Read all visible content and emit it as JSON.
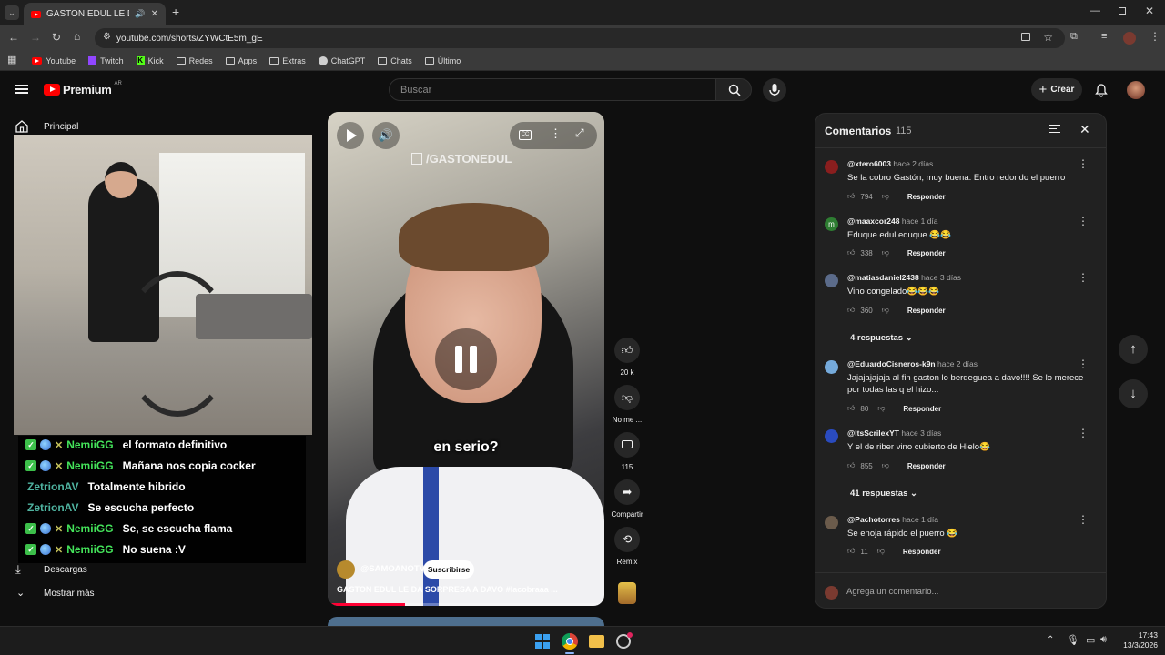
{
  "browser": {
    "tab_title": "GASTON EDUL LE DA SORP",
    "url": "youtube.com/shorts/ZYWCtE5m_gE",
    "bookmarks": [
      "Youtube",
      "Twitch",
      "Kick",
      "Redes",
      "Apps",
      "Extras",
      "ChatGPT",
      "Chats",
      "Último"
    ]
  },
  "youtube": {
    "logo_text": "Premium",
    "logo_country": "AR",
    "search_placeholder": "Buscar",
    "create_label": "Crear",
    "sidebar": {
      "home": "Principal",
      "downloads": "Descargas",
      "show_more": "Mostrar más"
    }
  },
  "chat": [
    {
      "user": "NemiiGG",
      "message": "el formato definitivo",
      "badges": true
    },
    {
      "user": "NemiiGG",
      "message": "Mañana nos copia cocker",
      "badges": true
    },
    {
      "user": "ZetrionAV",
      "message": "Totalmente hibrido",
      "badges": false
    },
    {
      "user": "ZetrionAV",
      "message": "Se escucha perfecto",
      "badges": false
    },
    {
      "user": "NemiiGG",
      "message": "Se, se escucha flama",
      "badges": true
    },
    {
      "user": "NemiiGG",
      "message": "No suena :V",
      "badges": true
    }
  ],
  "short": {
    "watermark": "/GASTONEDUL",
    "caption": "en serio?",
    "channel": "@SAMOANOTV",
    "subscribe_label": "Suscribirse",
    "title": "GASTON EDUL LE DA SORPRESA A DAVO ",
    "hashtag": "#lacobraaa ...",
    "progress_fraction": 0.28,
    "actions": {
      "likes": "20 k",
      "dislike_label": "No me ...",
      "comments": "115",
      "share_label": "Compartir",
      "remix_label": "Remix"
    }
  },
  "comments_panel": {
    "title": "Comentarios",
    "count": "115",
    "add_placeholder": "Agrega un comentario...",
    "reply_label": "Responder",
    "items": [
      {
        "author": "@xtero6003",
        "time": "hace 2 días",
        "text": "Se la cobro Gastón, muy buena. Entro redondo el puerro",
        "likes": "794",
        "avatar_color": "#8a1e1e"
      },
      {
        "author": "@maaxcor248",
        "time": "hace 1 día",
        "text": "Eduque edul eduque 😂😂",
        "likes": "338",
        "avatar_color": "#2e7d32",
        "avatar_letter": "m"
      },
      {
        "author": "@matiasdaniel2438",
        "time": "hace 3 días",
        "text": "Vino congelado😂😂😂",
        "likes": "360",
        "avatar_color": "#5b6b8a",
        "replies": "4 respuestas"
      },
      {
        "author": "@EduardoCisneros-k9n",
        "time": "hace 2 días",
        "text": "Jajajajajaja al fin gaston lo berdeguea a davo!!!! Se lo merece por todas las q el hizo...",
        "likes": "80",
        "avatar_color": "#75aadb"
      },
      {
        "author": "@ItsScrilexYT",
        "time": "hace 3 días",
        "text": "Y el de riber vino cubierto de Hielo😂",
        "likes": "855",
        "avatar_color": "#2a4bbf",
        "replies": "41 respuestas"
      },
      {
        "author": "@Pachotorres",
        "time": "hace 1 día",
        "text": "Se enoja rápido el puerro 😂",
        "likes": "11",
        "avatar_color": "#6b5b4b"
      }
    ]
  },
  "taskbar": {
    "time": "17:43",
    "date": "13/3/2026"
  }
}
